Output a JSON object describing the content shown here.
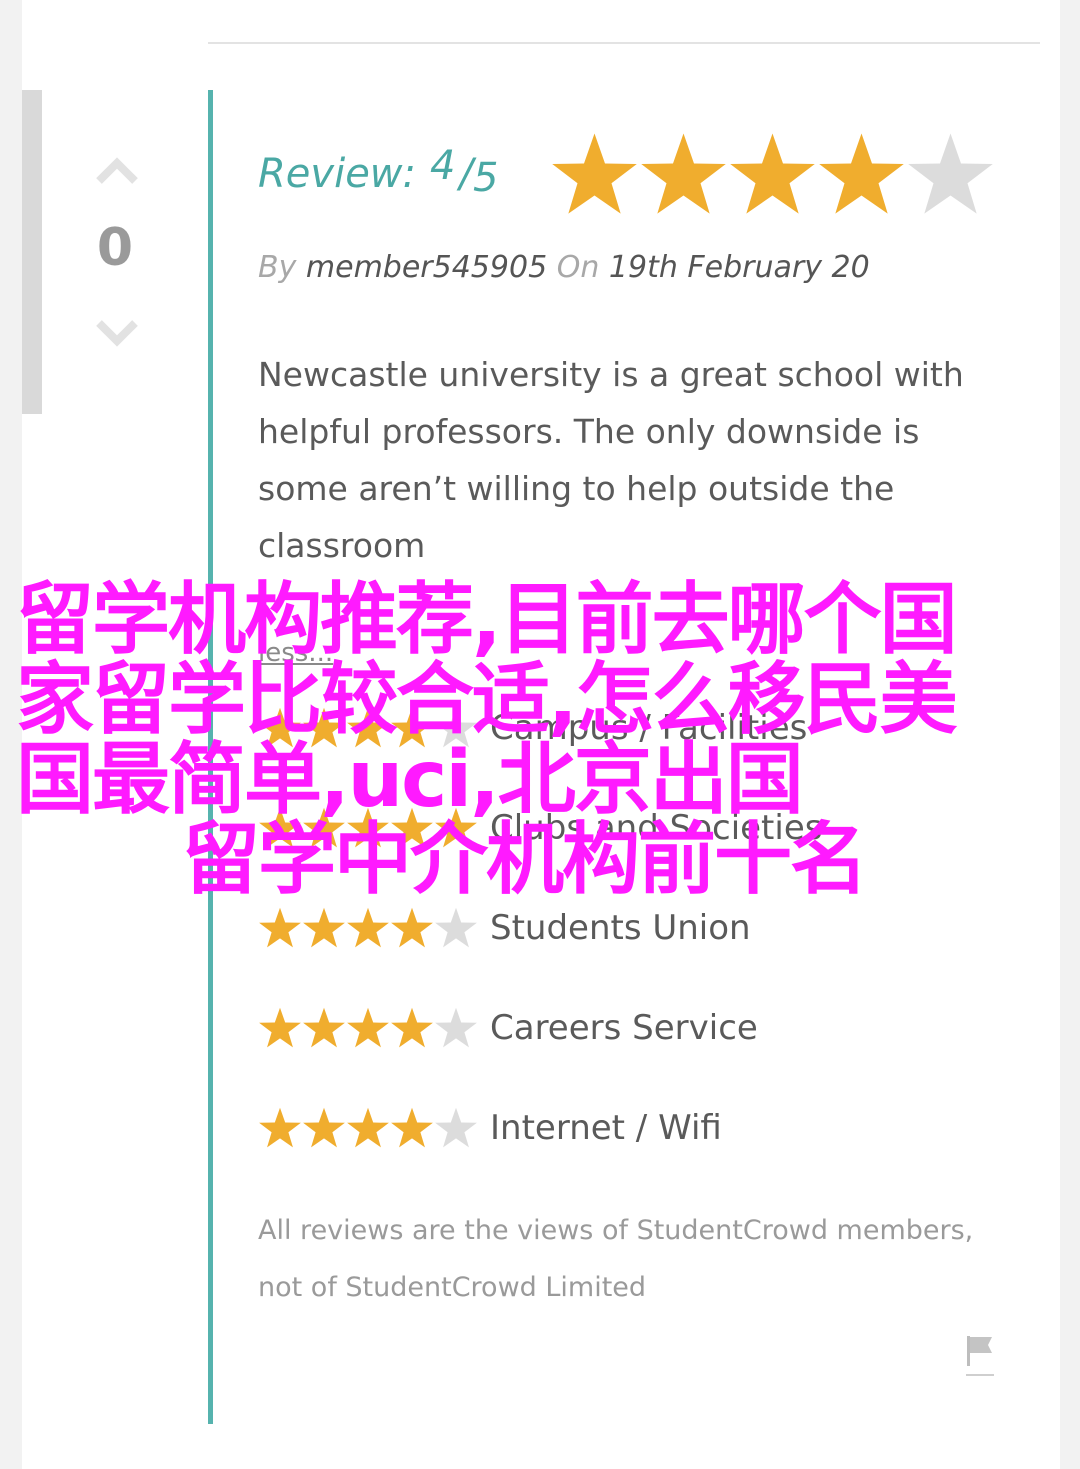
{
  "vote": {
    "count": "0"
  },
  "review": {
    "label": "Review:",
    "score": "4",
    "slash": "/",
    "out_of": "5",
    "rating": 4,
    "max_rating": 5,
    "by_label": "By",
    "author": "member545905",
    "on_label": "On",
    "date": "19th February 20",
    "body": "Newcastle university is a great school with helpful professors. The only downside is some aren’t willing to help outside the classroom",
    "less_link": "less..."
  },
  "category_ratings": [
    {
      "label": "Campus / Facilities",
      "rating": 4
    },
    {
      "label": "Clubs and Societies",
      "rating": 5
    },
    {
      "label": "Students Union",
      "rating": 4
    },
    {
      "label": "Careers Service",
      "rating": 4
    },
    {
      "label": "Internet / Wifi",
      "rating": 4
    }
  ],
  "disclaimer": "All reviews are the views of StudentCrowd members, not of StudentCrowd Limited",
  "overlay": {
    "line1": "留学机构推荐,目前去哪个国",
    "line2": "家留学比较合适,怎么移民美",
    "line3": "国最简单,uci,北京出国",
    "line4": "留学中介机构前十名"
  },
  "colors": {
    "accent": "#56b3ae",
    "star_filled": "#f0ad2e",
    "star_empty": "#dcdcdc",
    "overlay": "#ff1aff"
  },
  "icons": {
    "vote_up": "chevron-up-icon",
    "vote_down": "chevron-down-icon",
    "flag": "flag-icon",
    "star": "star-icon"
  }
}
